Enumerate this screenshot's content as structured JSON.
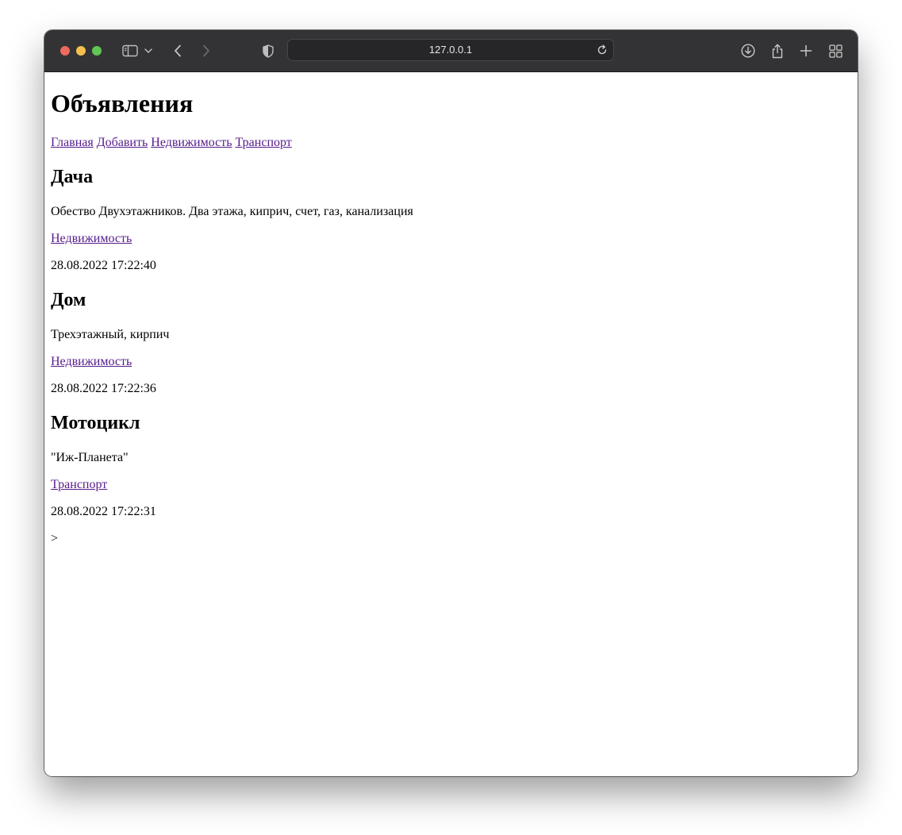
{
  "browser": {
    "url": "127.0.0.1",
    "icons": {
      "sidebar": "sidebar-icon",
      "chevron": "chevron-down-icon",
      "back": "back-arrow-icon",
      "forward": "forward-arrow-icon",
      "shield": "privacy-shield-icon",
      "reload": "reload-icon",
      "download": "download-icon",
      "share": "share-icon",
      "new_tab": "plus-icon",
      "tabs": "tab-overview-icon"
    }
  },
  "page": {
    "title": "Объявления",
    "nav": [
      {
        "label": "Главная"
      },
      {
        "label": "Добавить"
      },
      {
        "label": "Недвижимость"
      },
      {
        "label": "Транспорт"
      }
    ],
    "listings": [
      {
        "title": "Дача",
        "description": "Обество Двухэтажников. Два этажа, киприч, счет, газ, канализация",
        "category": "Недвижимость",
        "date": "28.08.2022 17:22:40"
      },
      {
        "title": "Дом",
        "description": "Трехэтажный, кирпич",
        "category": "Недвижимость",
        "date": "28.08.2022 17:22:36"
      },
      {
        "title": "Мотоцикл",
        "description": "\"Иж-Планета\"",
        "category": "Транспорт",
        "date": "28.08.2022 17:22:31"
      }
    ],
    "trailing_text": ">"
  },
  "colors": {
    "toolbar": "#333335",
    "link": "#551a8b",
    "traffic_red": "#ed6a5e",
    "traffic_yellow": "#f4bf4f",
    "traffic_green": "#61c554"
  }
}
